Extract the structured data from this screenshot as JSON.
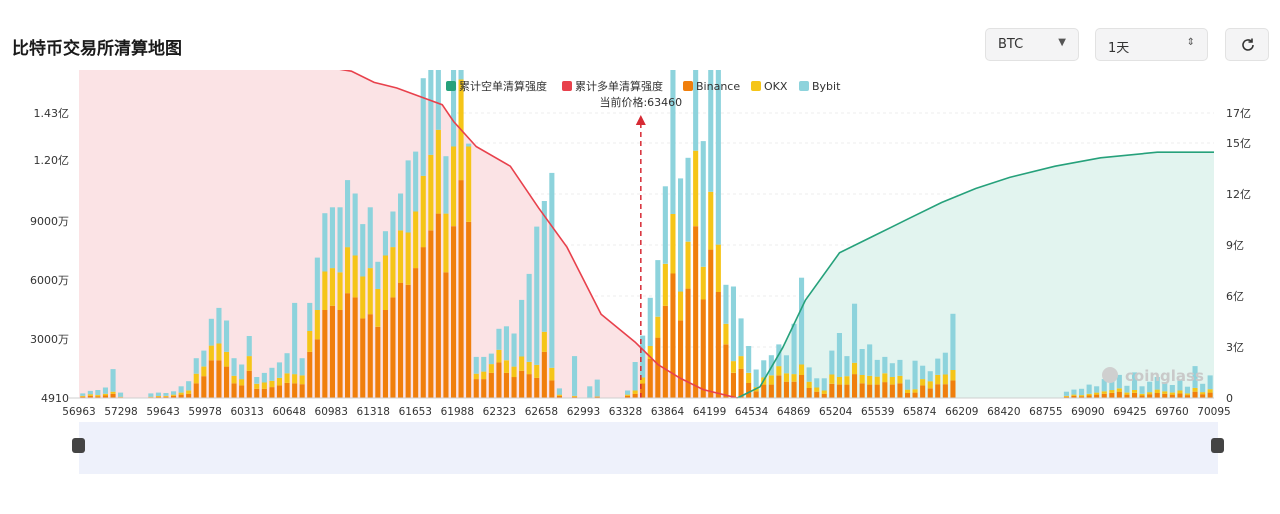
{
  "page": {
    "title": "比特币交易所清算地图",
    "symbol_select": "BTC",
    "timeframe_select": "1天",
    "refresh_icon": "refresh-icon",
    "watermark": "coinglass",
    "colors": {
      "short_cum": "#26a17b",
      "long_cum": "#e8414c",
      "binance": "#f07f0c",
      "okx": "#f5c518",
      "bybit": "#8dd3dc",
      "long_fill": "#fbe3e5",
      "short_fill": "#e2f4ef"
    }
  },
  "chart_data": {
    "type": "bar",
    "legend": [
      "累计空单清算强度",
      "累计多单清算强度",
      "Binance",
      "OKX",
      "Bybit"
    ],
    "current_price_label": "当前价格:63460",
    "current_price": 63460,
    "x_tick_labels": [
      "56963",
      "57298",
      "59643",
      "59978",
      "60313",
      "60648",
      "60983",
      "61318",
      "61653",
      "61988",
      "62323",
      "62658",
      "62993",
      "63328",
      "63864",
      "64199",
      "64534",
      "64869",
      "65204",
      "65539",
      "65874",
      "66209",
      "68420",
      "68755",
      "69090",
      "69425",
      "69760",
      "70095"
    ],
    "left_axis": {
      "ticks": [
        "4910",
        "3000万",
        "6000万",
        "9000万",
        "1.20亿",
        "1.43亿"
      ],
      "ylim": [
        0,
        143000000
      ]
    },
    "right_axis": {
      "ticks": [
        "0",
        "3亿",
        "6亿",
        "9亿",
        "12亿",
        "15亿",
        "17亿"
      ],
      "ylim": [
        0,
        1700000000
      ]
    },
    "bars": [
      [
        0.3,
        0.2,
        0.6
      ],
      [
        0.5,
        0.4,
        0.8
      ],
      [
        0.4,
        0.3,
        1.2
      ],
      [
        0.6,
        0.4,
        1.5
      ],
      [
        1.0,
        0.5,
        5.4
      ],
      [
        0.2,
        0.1,
        1.0
      ],
      [
        0,
        0,
        0
      ],
      [
        0,
        0,
        0
      ],
      [
        0,
        0,
        0
      ],
      [
        0.2,
        0.1,
        0.8
      ],
      [
        0.3,
        0.2,
        0.8
      ],
      [
        0.3,
        0.2,
        0.7
      ],
      [
        0.5,
        0.3,
        0.8
      ],
      [
        0.8,
        0.5,
        1.5
      ],
      [
        1.0,
        0.8,
        2.2
      ],
      [
        3.5,
        2.3,
        3.7
      ],
      [
        5.2,
        2.3,
        3.8
      ],
      [
        9.0,
        3.5,
        6.4
      ],
      [
        9.0,
        4.0,
        8.5
      ],
      [
        7.5,
        3.5,
        7.5
      ],
      [
        3.5,
        1.8,
        4.2
      ],
      [
        3.0,
        1.5,
        3.5
      ],
      [
        6.5,
        3.5,
        4.8
      ],
      [
        2.2,
        1.2,
        1.6
      ],
      [
        2.2,
        1.5,
        2.3
      ],
      [
        2.6,
        1.5,
        3.1
      ],
      [
        3.0,
        1.8,
        3.7
      ],
      [
        3.6,
        2.3,
        4.8
      ],
      [
        3.5,
        2.2,
        17.0
      ],
      [
        3.3,
        2.1,
        4.1
      ],
      [
        11.0,
        5.0,
        6.7
      ],
      [
        14.0,
        7.0,
        12.5
      ],
      [
        21.0,
        9.2,
        13.9
      ],
      [
        22.0,
        9.0,
        14.5
      ],
      [
        21.0,
        9.0,
        15.5
      ],
      [
        25.0,
        11.0,
        16.0
      ],
      [
        24.0,
        10.0,
        14.8
      ],
      [
        19.0,
        10.0,
        12.5
      ],
      [
        20.0,
        11.0,
        14.5
      ],
      [
        17.0,
        9.0,
        6.5
      ],
      [
        21.0,
        13.0,
        5.8
      ],
      [
        24.0,
        12.0,
        8.5
      ],
      [
        27.5,
        12.5,
        8.8
      ],
      [
        27.0,
        12.5,
        17.2
      ],
      [
        31.0,
        13.5,
        14.3
      ],
      [
        36.0,
        17.0,
        23.3
      ],
      [
        40.0,
        18.0,
        24.5
      ],
      [
        44.0,
        20.0,
        38.0
      ],
      [
        30.0,
        14.0,
        13.7
      ],
      [
        41.0,
        19.0,
        38.3
      ],
      [
        52.0,
        24.0,
        58.0
      ],
      [
        42.0,
        18.0,
        0.7
      ],
      [
        4.5,
        1.3,
        4.0
      ],
      [
        4.5,
        1.8,
        3.5
      ],
      [
        6.0,
        2.1,
        2.5
      ],
      [
        8.5,
        3.0,
        5.0
      ],
      [
        6.0,
        3.0,
        8.1
      ],
      [
        5.0,
        2.5,
        7.9
      ],
      [
        6.5,
        3.4,
        13.5
      ],
      [
        5.7,
        2.9,
        21.0
      ],
      [
        4.8,
        3.1,
        33.0
      ],
      [
        11.0,
        4.8,
        31.2
      ],
      [
        4.2,
        3.0,
        46.5
      ],
      [
        0.5,
        0.3,
        1.5
      ],
      [
        0,
        0,
        0
      ],
      [
        0.3,
        0.2,
        9.5
      ],
      [
        0,
        0,
        0
      ],
      [
        0,
        0,
        2.8
      ],
      [
        0.3,
        0.1,
        4.0
      ],
      [
        0,
        0,
        0
      ],
      [
        0,
        0,
        0
      ],
      [
        0,
        0,
        0
      ],
      [
        0.5,
        0.3,
        1.0
      ],
      [
        1.0,
        0.8,
        6.8
      ],
      [
        3.5,
        1.4,
        10.0
      ],
      [
        9.3,
        3.1,
        11.5
      ],
      [
        14.4,
        5.0,
        13.5
      ],
      [
        22.0,
        10.0,
        18.5
      ],
      [
        29.7,
        14.2,
        40.0
      ],
      [
        18.5,
        6.9,
        27.0
      ],
      [
        26.1,
        11.2,
        20.0
      ],
      [
        41.0,
        18.0,
        41.5
      ],
      [
        23.5,
        7.8,
        30.0
      ],
      [
        35.4,
        13.8,
        30.0
      ],
      [
        25.3,
        11.3,
        45.6
      ],
      [
        12.8,
        4.9,
        9.3
      ],
      [
        6.0,
        2.8,
        17.8
      ],
      [
        7.0,
        3.0,
        9.0
      ],
      [
        3.6,
        2.4,
        6.4
      ],
      [
        1.6,
        1.0,
        4.2
      ],
      [
        3.2,
        1.7,
        4.1
      ],
      [
        3.2,
        2.2,
        4.8
      ],
      [
        5.4,
        2.2,
        5.2
      ],
      [
        3.9,
        2.0,
        4.3
      ],
      [
        3.9,
        1.8,
        12.0
      ],
      [
        5.5,
        2.5,
        20.7
      ],
      [
        2.4,
        1.5,
        3.4
      ],
      [
        1.5,
        1.0,
        2.2
      ],
      [
        1.0,
        0.8,
        2.9
      ],
      [
        3.4,
        2.2,
        5.7
      ],
      [
        3.2,
        1.8,
        10.5
      ],
      [
        3.2,
        2.0,
        4.8
      ],
      [
        5.7,
        2.7,
        14.1
      ],
      [
        3.5,
        2.0,
        6.2
      ],
      [
        3.2,
        2.1,
        7.5
      ],
      [
        3.2,
        1.9,
        4.0
      ],
      [
        3.8,
        2.1,
        3.9
      ],
      [
        3.2,
        1.8,
        3.3
      ],
      [
        3.5,
        1.8,
        3.8
      ],
      [
        1.2,
        0.8,
        2.4
      ],
      [
        1.3,
        0.8,
        6.8
      ],
      [
        3.0,
        1.5,
        3.2
      ],
      [
        2.3,
        1.7,
        2.4
      ],
      [
        3.3,
        2.2,
        3.9
      ],
      [
        3.3,
        2.3,
        5.2
      ],
      [
        4.2,
        2.5,
        13.4
      ],
      [
        0,
        0,
        0
      ],
      [
        0,
        0,
        0
      ],
      [
        0,
        0,
        0
      ],
      [
        0,
        0,
        0
      ],
      [
        0,
        0,
        0
      ],
      [
        0,
        0,
        0
      ],
      [
        0,
        0,
        0
      ],
      [
        0,
        0,
        0
      ],
      [
        0,
        0,
        0
      ],
      [
        0,
        0,
        0
      ],
      [
        0,
        0,
        0
      ],
      [
        0,
        0,
        0
      ],
      [
        0,
        0,
        0
      ],
      [
        0,
        0,
        0
      ],
      [
        0.3,
        0.2,
        1.0
      ],
      [
        0.5,
        0.3,
        1.2
      ],
      [
        0.4,
        0.3,
        1.5
      ],
      [
        0.6,
        0.4,
        2.2
      ],
      [
        0.8,
        0.5,
        1.5
      ],
      [
        1.0,
        0.6,
        2.9
      ],
      [
        1.2,
        0.7,
        2.5
      ],
      [
        1.5,
        0.8,
        3.2
      ],
      [
        0.8,
        0.5,
        1.6
      ],
      [
        1.2,
        0.7,
        4.2
      ],
      [
        0.6,
        0.4,
        1.8
      ],
      [
        0.9,
        0.5,
        2.5
      ],
      [
        1.2,
        0.8,
        3.0
      ],
      [
        1.0,
        0.6,
        2.2
      ],
      [
        0.8,
        0.5,
        1.8
      ],
      [
        1.1,
        0.7,
        2.4
      ],
      [
        0.7,
        0.4,
        1.6
      ],
      [
        1.5,
        0.9,
        5.2
      ],
      [
        0.9,
        0.5,
        2.0
      ],
      [
        1.3,
        0.8,
        3.3
      ]
    ],
    "long_cum_curve": [
      [
        0,
        1.32
      ],
      [
        0.04,
        1.31
      ],
      [
        0.06,
        1.3
      ],
      [
        0.11,
        1.3
      ],
      [
        0.15,
        1.29
      ],
      [
        0.175,
        1.25
      ],
      [
        0.21,
        1.19
      ],
      [
        0.24,
        1.17
      ],
      [
        0.26,
        1.13
      ],
      [
        0.28,
        1.11
      ],
      [
        0.3,
        1.08
      ],
      [
        0.32,
        1.05
      ],
      [
        0.33,
        0.99
      ],
      [
        0.35,
        0.9
      ],
      [
        0.38,
        0.83
      ],
      [
        0.405,
        0.68
      ],
      [
        0.43,
        0.54
      ],
      [
        0.46,
        0.3
      ],
      [
        0.49,
        0.2
      ],
      [
        0.51,
        0.12
      ],
      [
        0.53,
        0.07
      ],
      [
        0.55,
        0.03
      ],
      [
        0.58,
        0.0
      ]
    ],
    "short_cum_curve": [
      [
        0.58,
        0.0
      ],
      [
        0.6,
        0.04
      ],
      [
        0.62,
        0.18
      ],
      [
        0.64,
        0.35
      ],
      [
        0.67,
        0.52
      ],
      [
        0.7,
        0.58
      ],
      [
        0.73,
        0.64
      ],
      [
        0.76,
        0.7
      ],
      [
        0.79,
        0.75
      ],
      [
        0.82,
        0.79
      ],
      [
        0.86,
        0.83
      ],
      [
        0.9,
        0.86
      ],
      [
        0.95,
        0.88
      ],
      [
        1.0,
        0.88
      ]
    ],
    "curve_note_units": "normalized to right axis max (17亿)"
  }
}
